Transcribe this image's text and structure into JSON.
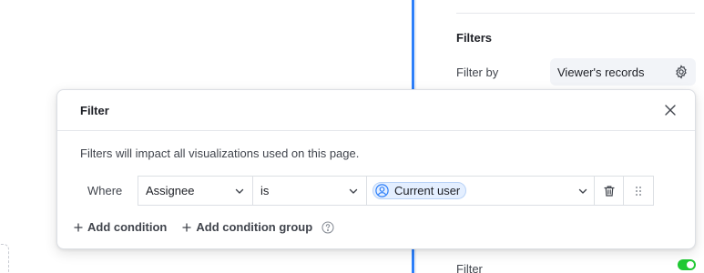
{
  "right_panel": {
    "section_title": "Filters",
    "filter_by_label": "Filter by",
    "filter_by_value": "Viewer's records",
    "bottom_label": "Filter",
    "bottom_toggle_on": true
  },
  "dialog": {
    "title": "Filter",
    "description": "Filters will impact all visualizations used on this page.",
    "condition": {
      "where_label": "Where",
      "field": "Assignee",
      "operator": "is",
      "value": "Current user"
    },
    "add_condition_label": "Add condition",
    "add_condition_group_label": "Add condition group"
  },
  "colors": {
    "accent": "#2d7ff9",
    "chip_bg": "#e4efff",
    "toggle_on": "#20c933"
  }
}
